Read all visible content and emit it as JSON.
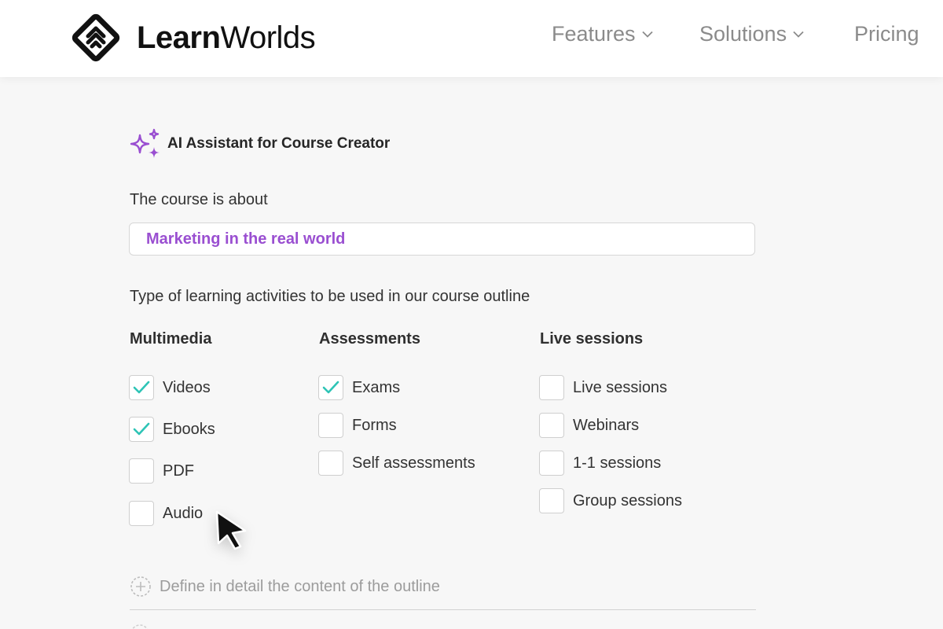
{
  "header": {
    "logo": {
      "bold": "Learn",
      "regular": "Worlds"
    },
    "nav": [
      {
        "label": "Features"
      },
      {
        "label": "Solutions"
      },
      {
        "label": "Pricing"
      }
    ]
  },
  "assistant": {
    "title": "AI Assistant for Course Creator",
    "icon": "sparkles-icon",
    "accent_color": "#9a4fd1"
  },
  "course": {
    "label": "The course is about",
    "value": "Marketing in the real world"
  },
  "activities": {
    "label": "Type of learning activities to be used in our course outline",
    "check_color": "#2ec4b6",
    "columns": [
      {
        "heading": "Multimedia",
        "options": [
          {
            "label": "Videos",
            "checked": true
          },
          {
            "label": "Ebooks",
            "checked": true
          },
          {
            "label": "PDF",
            "checked": false
          },
          {
            "label": "Audio",
            "checked": false
          }
        ]
      },
      {
        "heading": "Assessments",
        "options": [
          {
            "label": "Exams",
            "checked": true
          },
          {
            "label": "Forms",
            "checked": false
          },
          {
            "label": "Self assessments",
            "checked": false
          }
        ]
      },
      {
        "heading": "Live sessions",
        "options": [
          {
            "label": "Live sessions",
            "checked": false
          },
          {
            "label": "Webinars",
            "checked": false
          },
          {
            "label": "1-1 sessions",
            "checked": false
          },
          {
            "label": "Group sessions",
            "checked": false
          }
        ]
      }
    ]
  },
  "define": {
    "label": "Define in detail the content of the outline",
    "icon": "add-circle-icon"
  }
}
